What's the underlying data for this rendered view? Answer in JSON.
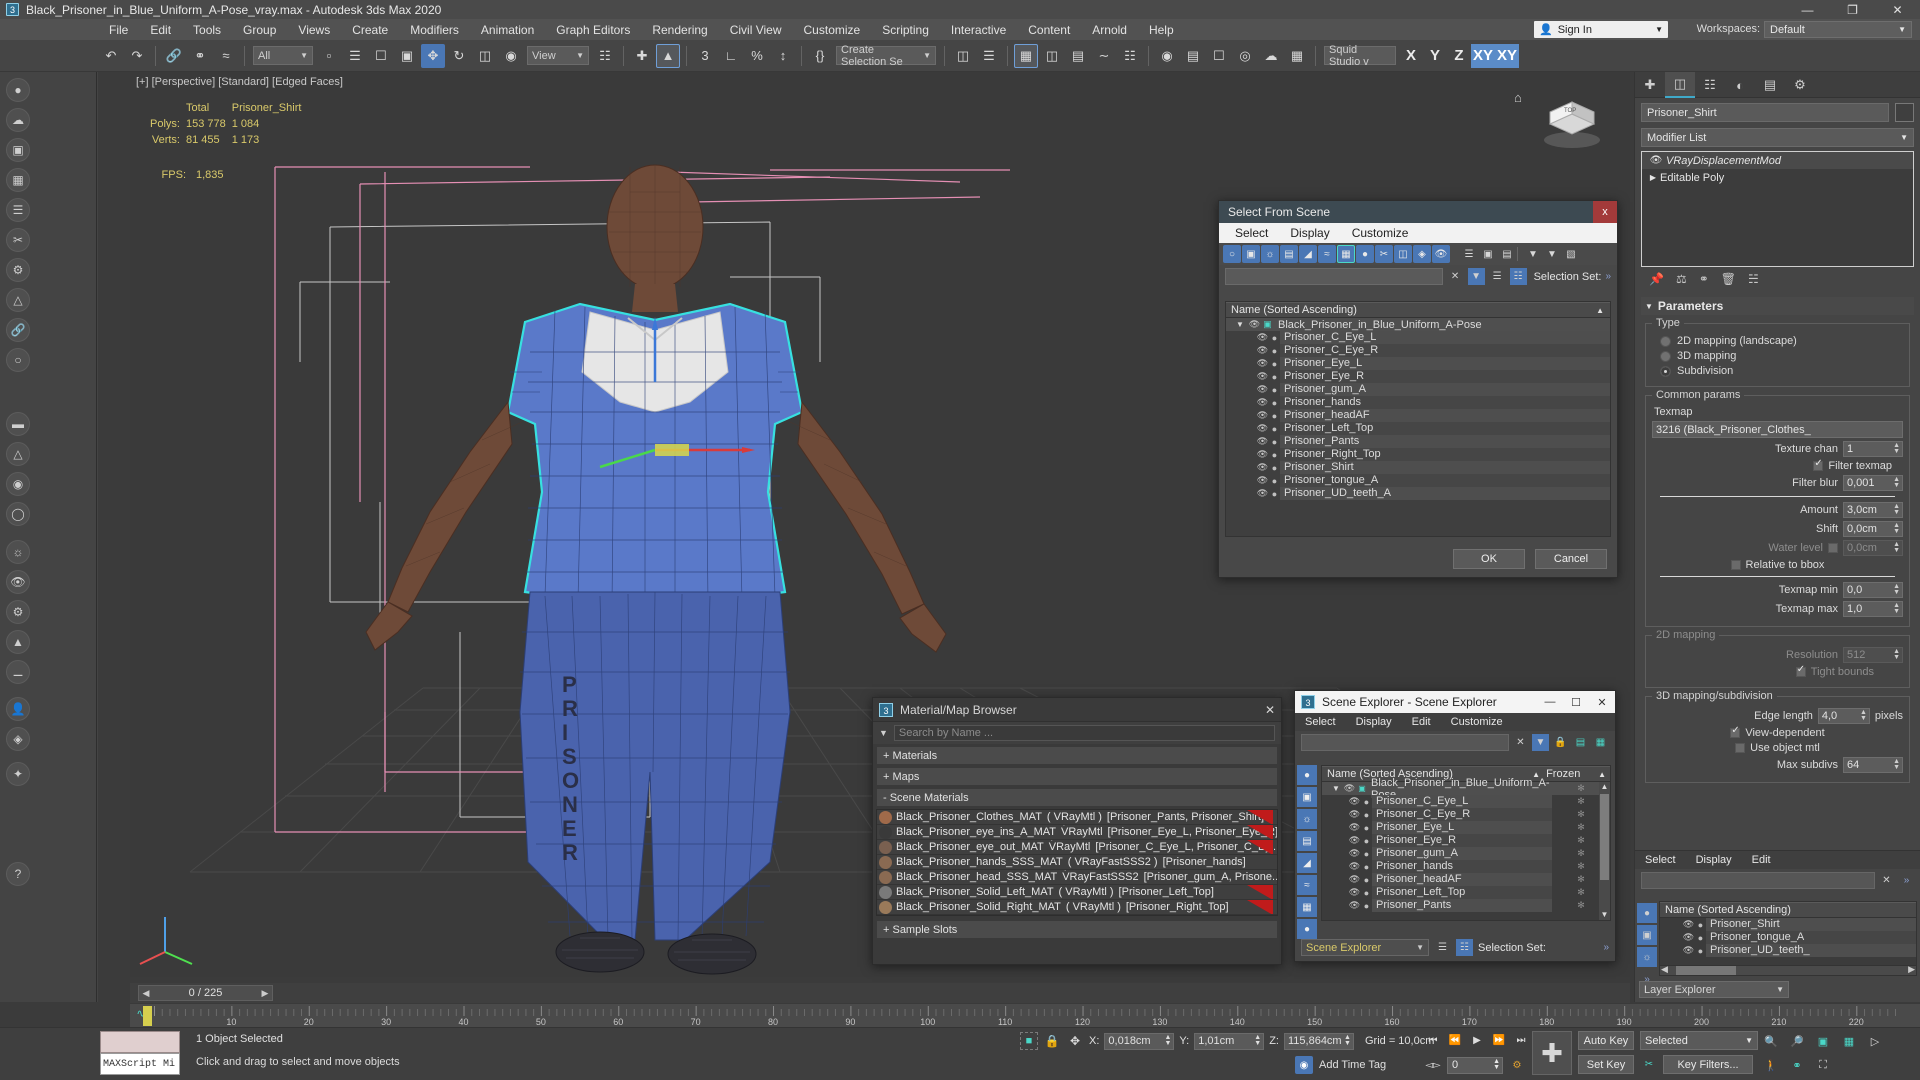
{
  "titlebar": {
    "app_icon": "max-icon",
    "title": "Black_Prisoner_in_Blue_Uniform_A-Pose_vray.max - Autodesk 3ds Max 2020",
    "minimize": "—",
    "maximize": "❐",
    "close": "✕"
  },
  "menubar": {
    "items": [
      "File",
      "Edit",
      "Tools",
      "Group",
      "Views",
      "Create",
      "Modifiers",
      "Animation",
      "Graph Editors",
      "Rendering",
      "Civil View",
      "Customize",
      "Scripting",
      "Interactive",
      "Content",
      "Arnold",
      "Help"
    ],
    "sign_in": "Sign In",
    "workspaces_label": "Workspaces:",
    "workspace_value": "Default"
  },
  "toolbar": {
    "selection_filter": "All",
    "reference_coord": "View",
    "named_selection_sets": "Create Selection Se",
    "studio_name": "Squid Studio v",
    "axis_buttons": [
      "X",
      "Y",
      "Z",
      "XY",
      "XY"
    ]
  },
  "viewport": {
    "label": "[+] [Perspective] [Standard] [Edged Faces]",
    "stats": {
      "col_total": "Total",
      "col_object": "Prisoner_Shirt",
      "rows": [
        {
          "label": "Polys:",
          "total": "153 778",
          "object": "1 084"
        },
        {
          "label": "Verts:",
          "total": "81 455",
          "object": "1 173"
        }
      ],
      "fps_label": "FPS:",
      "fps_value": "1,835"
    },
    "viewcube_face": "TOP"
  },
  "command_panel": {
    "tabs": [
      "create-tab",
      "modify-tab",
      "hierarchy-tab",
      "motion-tab",
      "display-tab",
      "utilities-tab"
    ],
    "object_name": "Prisoner_Shirt",
    "modifier_list_label": "Modifier List",
    "stack": [
      {
        "name": "VRayDisplacementMod",
        "italic": true,
        "selected": true
      },
      {
        "name": "Editable Poly",
        "italic": false,
        "selected": false
      }
    ],
    "parameters": {
      "rollout_title": "Parameters",
      "type_group": "Type",
      "type_options": [
        {
          "label": "2D mapping (landscape)",
          "selected": false
        },
        {
          "label": "3D mapping",
          "selected": false
        },
        {
          "label": "Subdivision",
          "selected": true
        }
      ],
      "common_group": "Common params",
      "texmap_label": "Texmap",
      "texmap_value": "3216 (Black_Prisoner_Clothes_",
      "texture_chan_label": "Texture chan",
      "texture_chan_value": "1",
      "filter_texmap_label": "Filter texmap",
      "filter_texmap_checked": true,
      "filter_blur_label": "Filter blur",
      "filter_blur_value": "0,001",
      "amount_label": "Amount",
      "amount_value": "3,0cm",
      "shift_label": "Shift",
      "shift_value": "0,0cm",
      "water_level_label": "Water level",
      "water_level_value": "0,0cm",
      "water_level_checked": false,
      "relative_bbox_label": "Relative to bbox",
      "relative_bbox_checked": false,
      "texmap_min_label": "Texmap min",
      "texmap_min_value": "0,0",
      "texmap_max_label": "Texmap max",
      "texmap_max_value": "1,0",
      "mapping2d_group": "2D mapping",
      "resolution_label": "Resolution",
      "resolution_value": "512",
      "tight_bounds_label": "Tight bounds",
      "tight_bounds_checked": true,
      "mapping3d_group": "3D mapping/subdivision",
      "edge_length_label": "Edge length",
      "edge_length_value": "4,0",
      "edge_length_unit": "pixels",
      "view_dependent_label": "View-dependent",
      "view_dependent_checked": true,
      "use_object_mtl_label": "Use object mtl",
      "use_object_mtl_checked": false,
      "max_subdivs_label": "Max subdivs",
      "max_subdivs_value": "64"
    },
    "layer_explorer": {
      "menu": [
        "Select",
        "Display",
        "Edit"
      ],
      "column_header": "Name (Sorted Ascending)",
      "rows": [
        "Prisoner_Shirt",
        "Prisoner_tongue_A",
        "Prisoner_UD_teeth_"
      ],
      "footer_label": "Layer Explorer"
    }
  },
  "select_from_scene": {
    "title": "Select From Scene",
    "close": "x",
    "menu": [
      "Select",
      "Display",
      "Customize"
    ],
    "selection_set_label": "Selection Set:",
    "column_header": "Name (Sorted Ascending)",
    "root": "Black_Prisoner_in_Blue_Uniform_A-Pose",
    "items": [
      "Prisoner_C_Eye_L",
      "Prisoner_C_Eye_R",
      "Prisoner_Eye_L",
      "Prisoner_Eye_R",
      "Prisoner_gum_A",
      "Prisoner_hands",
      "Prisoner_headAF",
      "Prisoner_Left_Top",
      "Prisoner_Pants",
      "Prisoner_Right_Top",
      "Prisoner_Shirt",
      "Prisoner_tongue_A",
      "Prisoner_UD_teeth_A"
    ],
    "ok": "OK",
    "cancel": "Cancel"
  },
  "material_browser": {
    "title": "Material/Map Browser",
    "search_placeholder": "Search by Name ...",
    "sections": [
      {
        "label": "+ Materials"
      },
      {
        "label": "+ Maps"
      },
      {
        "label": "- Scene Materials"
      }
    ],
    "footer_section": "+ Sample Slots",
    "materials": [
      {
        "swatch": "#a06a4a",
        "name": "Black_Prisoner_Clothes_MAT",
        "type": "( VRayMtl )",
        "objects": "[Prisoner_Pants, Prisoner_Shirt]",
        "flagged": true
      },
      {
        "swatch": "#3a3a3a",
        "name": "Black_Prisoner_eye_ins_A_MAT",
        "type": "( VRayMtl )",
        "objects": "[Prisoner_Eye_L, Prisoner_Eye_R]",
        "flagged": true
      },
      {
        "swatch": "#7a6050",
        "name": "Black_Prisoner_eye_out_MAT",
        "type": "( VRayMtl )",
        "objects": "[Prisoner_C_Eye_L, Prisoner_C_Ey...",
        "flagged": true
      },
      {
        "swatch": "#8a6a52",
        "name": "Black_Prisoner_hands_SSS_MAT",
        "type": "( VRayFastSSS2 )",
        "objects": "[Prisoner_hands]",
        "flagged": false
      },
      {
        "swatch": "#8a6a52",
        "name": "Black_Prisoner_head_SSS_MAT",
        "type": "( VRayFastSSS2 )",
        "objects": "[Prisoner_gum_A, Prisone...",
        "flagged": false
      },
      {
        "swatch": "#7a7a7a",
        "name": "Black_Prisoner_Solid_Left_MAT",
        "type": "( VRayMtl )",
        "objects": "[Prisoner_Left_Top]",
        "flagged": true
      },
      {
        "swatch": "#9a7a5a",
        "name": "Black_Prisoner_Solid_Right_MAT",
        "type": "( VRayMtl )",
        "objects": "[Prisoner_Right_Top]",
        "flagged": true
      }
    ]
  },
  "scene_explorer": {
    "title": "Scene Explorer - Scene Explorer",
    "minimize": "—",
    "maximize": "☐",
    "close": "✕",
    "menu": [
      "Select",
      "Display",
      "Edit",
      "Customize"
    ],
    "column_name": "Name (Sorted Ascending)",
    "column_frozen": "Frozen",
    "root": "Black_Prisoner_in_Blue_Uniform_A-Pose",
    "items": [
      "Prisoner_C_Eye_L",
      "Prisoner_C_Eye_R",
      "Prisoner_Eye_L",
      "Prisoner_Eye_R",
      "Prisoner_gum_A",
      "Prisoner_hands",
      "Prisoner_headAF",
      "Prisoner_Left_Top",
      "Prisoner_Pants"
    ],
    "footer_label": "Scene Explorer",
    "selection_set_label": "Selection Set:"
  },
  "timeline": {
    "current_frame": "0 / 225",
    "tick_labels": [
      "10",
      "20",
      "30",
      "40",
      "50",
      "60",
      "70",
      "80",
      "90",
      "100",
      "110",
      "120",
      "130",
      "140",
      "150",
      "160",
      "170",
      "180",
      "190",
      "200",
      "210",
      "220"
    ]
  },
  "statusbar": {
    "maxscript_label": "MAXScript Mi",
    "selection_status": "1 Object Selected",
    "prompt": "Click and drag to select and move objects",
    "coords": [
      {
        "axis": "X:",
        "value": "0,018cm"
      },
      {
        "axis": "Y:",
        "value": "1,01cm"
      },
      {
        "axis": "Z:",
        "value": "115,864cm"
      }
    ],
    "grid": "Grid = 10,0cm",
    "add_time_tag": "Add Time Tag",
    "auto_key": "Auto Key",
    "set_key": "Set Key",
    "key_mode": "Selected",
    "key_filters": "Key Filters...",
    "frame_field": "0"
  },
  "colors": {
    "accent_blue": "#4a77b5",
    "teal": "#3fa9c9",
    "yellow_stat": "#d9c96a",
    "red_close": "#a33a3a",
    "selection_cyan": "#37e0e0"
  }
}
